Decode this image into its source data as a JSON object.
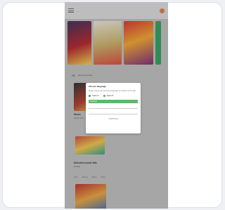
{
  "app": {
    "brand": "...",
    "accent": "#2f9e57"
  },
  "section": {
    "label": "Recommended"
  },
  "movie": {
    "title": "Movie",
    "subtitle": "Movie info"
  },
  "item2": {
    "title": "Selected movie title",
    "subtitle": "Details"
  },
  "actions": [
    "Like",
    "Share",
    "Save",
    "More"
  ],
  "dialog": {
    "title": "Choose language",
    "text": "Please select your preferred language to continue to the app.",
    "option_a": "Option A",
    "option_b": "Option B",
    "input_value": "Selected",
    "button": "CONTINUE"
  }
}
